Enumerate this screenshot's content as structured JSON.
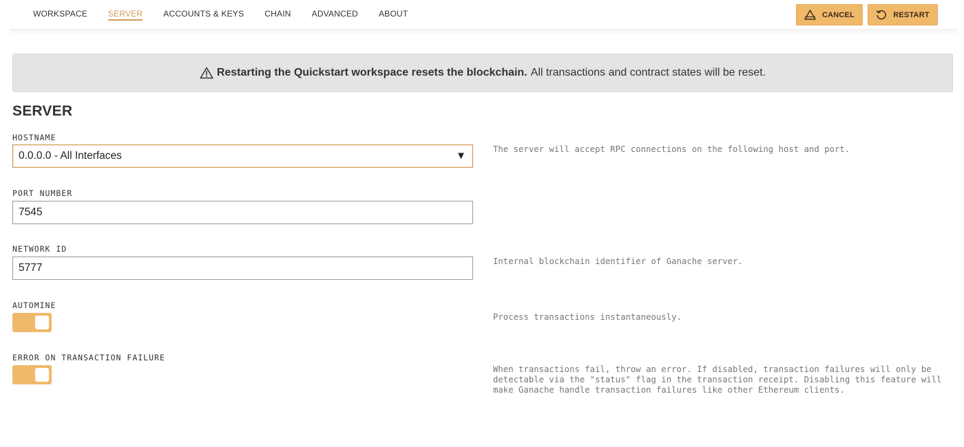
{
  "nav": {
    "items": [
      {
        "label": "WORKSPACE",
        "active": false
      },
      {
        "label": "SERVER",
        "active": true
      },
      {
        "label": "ACCOUNTS & KEYS",
        "active": false
      },
      {
        "label": "CHAIN",
        "active": false
      },
      {
        "label": "ADVANCED",
        "active": false
      },
      {
        "label": "ABOUT",
        "active": false
      }
    ]
  },
  "actions": {
    "cancel_label": "CANCEL",
    "cancel_icon": "warning-triangle-icon",
    "restart_label": "RESTART",
    "restart_icon": "restart-icon"
  },
  "banner": {
    "icon": "warning-triangle-icon",
    "strong_text": "Restarting the Quickstart workspace resets the blockchain.",
    "text": "All transactions and contract states will be reset."
  },
  "section": {
    "title": "SERVER"
  },
  "fields": {
    "hostname": {
      "label": "HOSTNAME",
      "value": "0.0.0.0 - All Interfaces",
      "description": "The server will accept RPC connections on the following host and port."
    },
    "port": {
      "label": "PORT NUMBER",
      "value": "7545"
    },
    "network_id": {
      "label": "NETWORK ID",
      "value": "5777",
      "description": "Internal blockchain identifier of Ganache server."
    },
    "automine": {
      "label": "AUTOMINE",
      "enabled": true,
      "description": "Process transactions instantaneously."
    },
    "error_on_failure": {
      "label": "ERROR ON TRANSACTION FAILURE",
      "enabled": true,
      "description": "When transactions fail, throw an error. If disabled, transaction failures will only be detectable via the \"status\" flag in the transaction receipt. Disabling this feature will make Ganache handle transaction failures like other Ethereum clients."
    }
  },
  "colors": {
    "accent": "#f0b96a",
    "active_nav": "#d19a5a",
    "banner_bg": "#e4e4e4"
  }
}
